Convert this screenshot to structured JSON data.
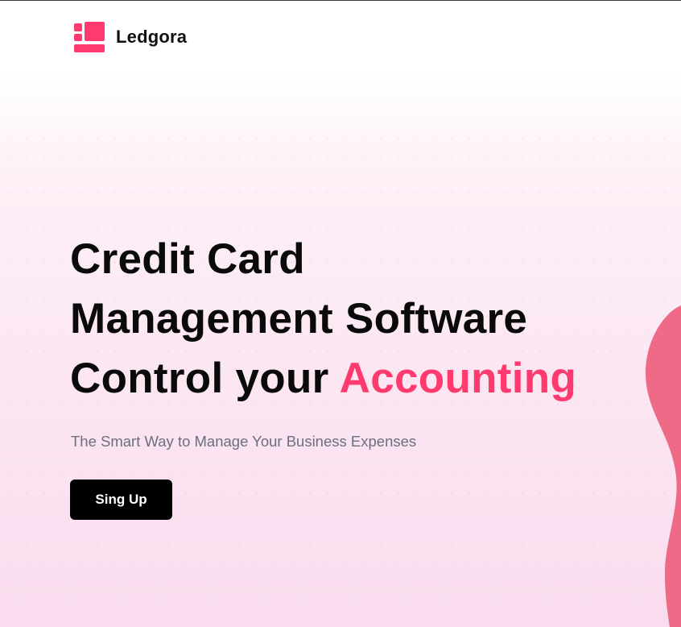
{
  "brand": {
    "name": "Ledgora",
    "logo_icon": "ledgora-logo-icon",
    "logo_color": "#ff3a6e"
  },
  "hero": {
    "title_line1": "Credit Card",
    "title_line2": "Management Software",
    "title_line3_prefix": "Control your ",
    "title_line3_accent": "Accounting",
    "accent_color": "#ff3a6e",
    "subtitle": "The Smart Way to Manage Your Business Expenses",
    "cta_label": "Sing Up"
  },
  "colors": {
    "background_top": "#ffffff",
    "background_bottom": "#fadcee",
    "text_primary": "#0a0a0a",
    "text_muted": "#6b6f7e",
    "button_bg": "#000000",
    "button_text": "#ffffff",
    "blob": "#ee6a86"
  }
}
